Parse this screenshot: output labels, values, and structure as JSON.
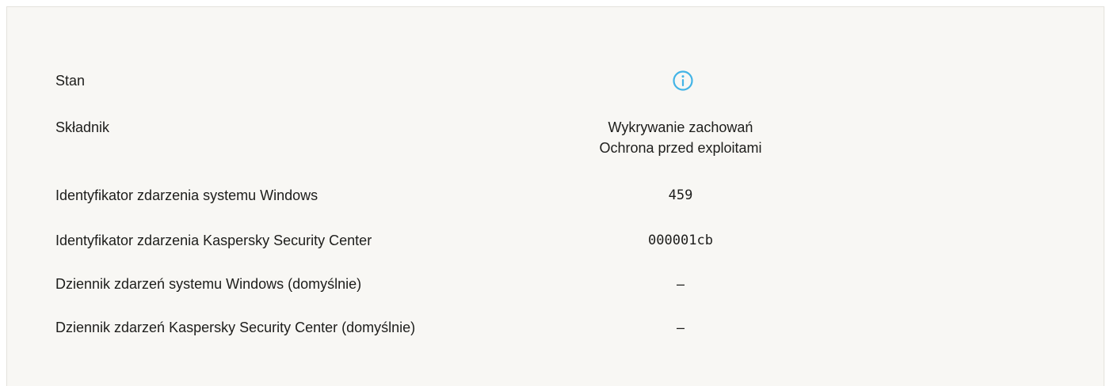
{
  "rows": [
    {
      "label": "Stan",
      "icon": "info-icon",
      "icon_color": "#43b4e6"
    },
    {
      "label": "Składnik",
      "value_lines": [
        "Wykrywanie zachowań",
        "Ochrona przed exploitami"
      ]
    },
    {
      "label": "Identyfikator zdarzenia systemu Windows",
      "value": "459"
    },
    {
      "label": "Identyfikator zdarzenia Kaspersky Security Center",
      "value": "000001cb"
    },
    {
      "label": "Dziennik zdarzeń systemu Windows (domyślnie)",
      "value": "–"
    },
    {
      "label": "Dziennik zdarzeń Kaspersky Security Center (domyślnie)",
      "value": "–"
    }
  ]
}
